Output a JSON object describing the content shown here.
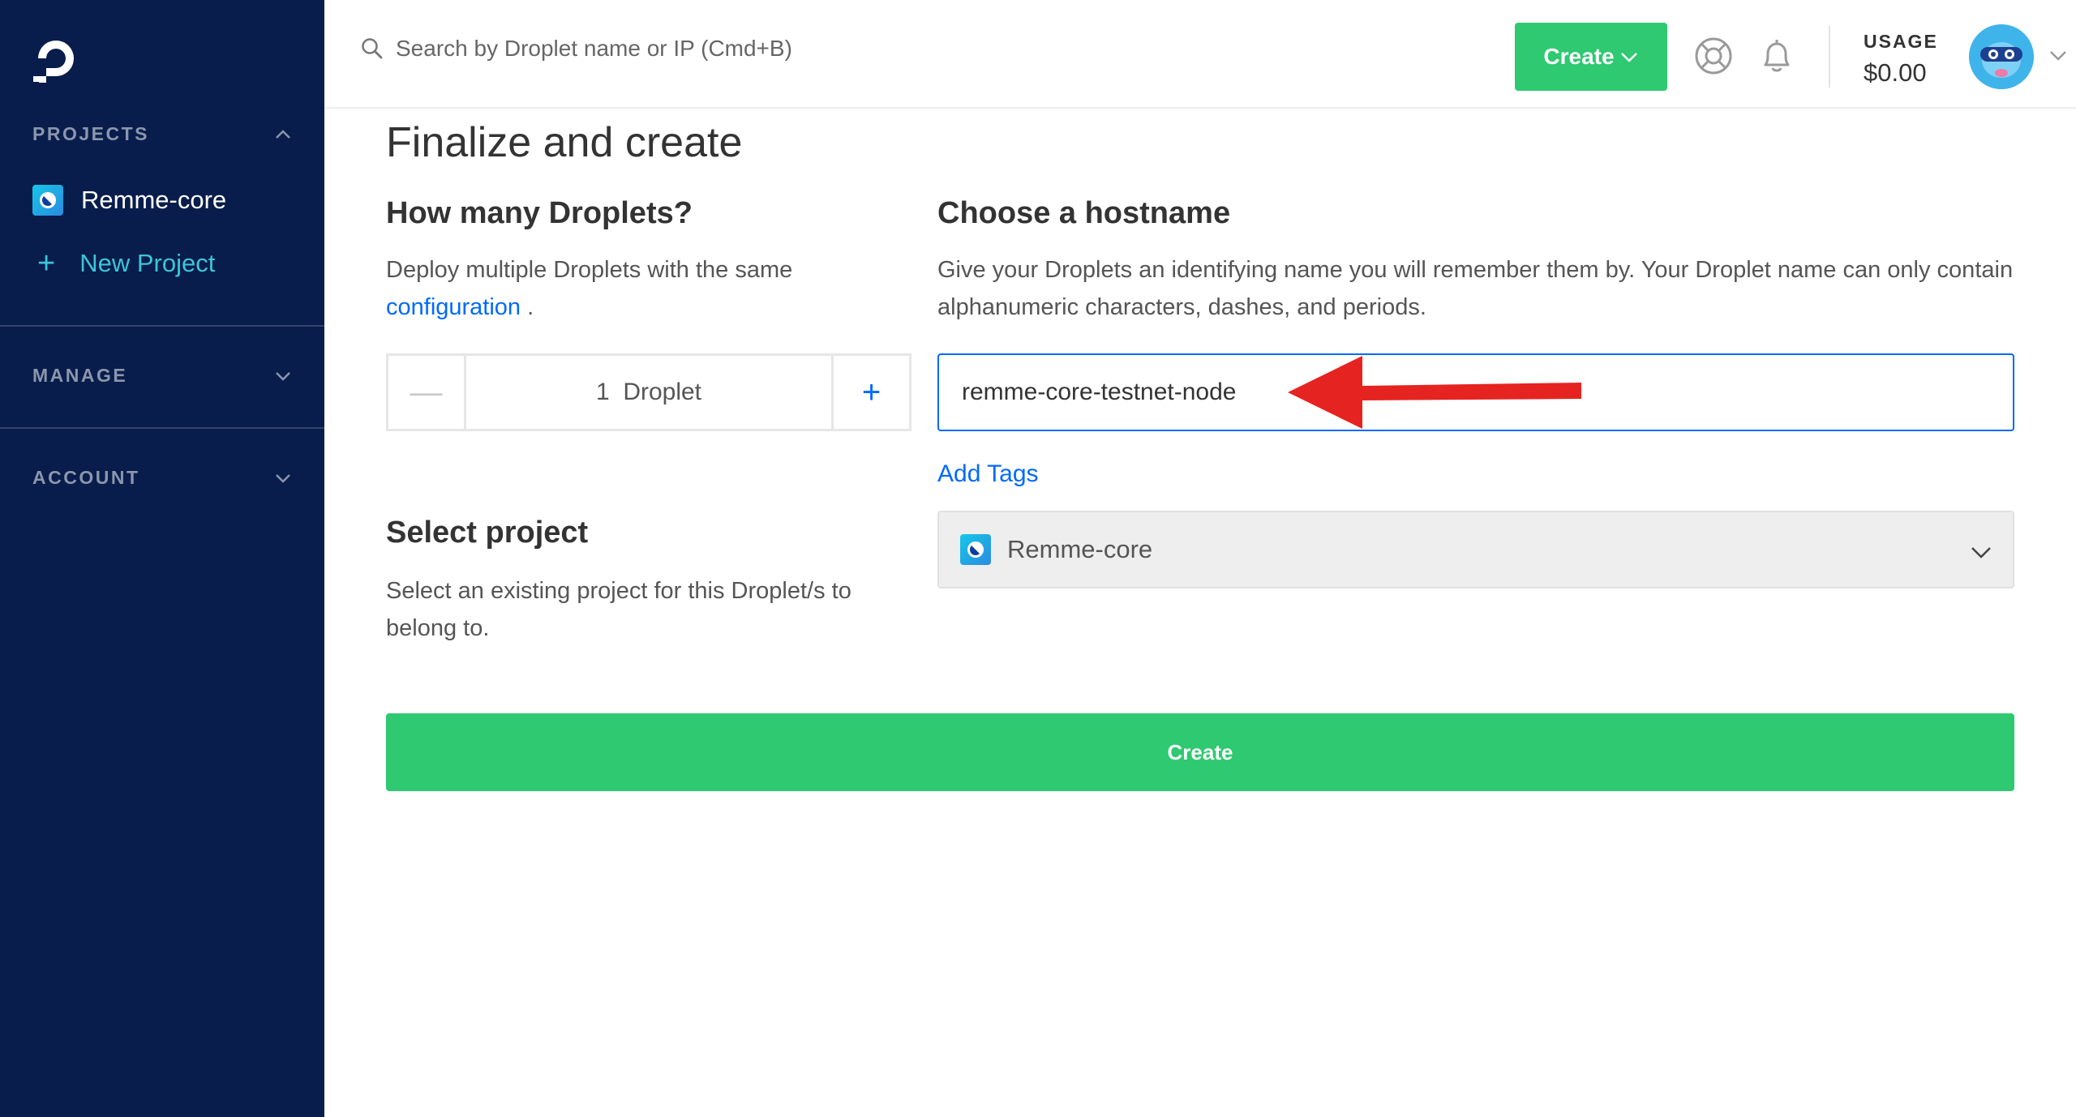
{
  "sidebar": {
    "projects_label": "PROJECTS",
    "current_project": "Remme-core",
    "new_project_label": "New Project",
    "manage_label": "MANAGE",
    "account_label": "ACCOUNT"
  },
  "header": {
    "search_placeholder": "Search by Droplet name or IP (Cmd+B)",
    "create_label": "Create",
    "usage_label": "USAGE",
    "usage_value": "$0.00"
  },
  "main": {
    "title": "Finalize and create",
    "droplets_heading": "How many Droplets?",
    "droplets_desc": "Deploy multiple Droplets with the same",
    "droplets_link": "configuration",
    "droplets_desc_end": " .",
    "droplet_count": "1",
    "droplet_unit": "Droplet",
    "hostname_heading": "Choose a hostname",
    "hostname_desc": "Give your Droplets an identifying name you will remember them by. Your Droplet name can only contain alphanumeric characters, dashes, and periods.",
    "hostname_value": "remme-core-testnet-node",
    "add_tags_label": "Add Tags",
    "project_heading": "Select project",
    "project_desc": "Select an existing project for this Droplet/s to belong to.",
    "selected_project": "Remme-core",
    "create_button_label": "Create"
  },
  "icons": {
    "logo": "digitalocean-logo-icon",
    "search": "search-icon",
    "support": "lifebuoy-icon",
    "notifications": "bell-icon",
    "annotation": "red-arrow-icon"
  },
  "colors": {
    "sidebar_bg": "#081d4b",
    "accent_green": "#2ec971",
    "link_blue": "#0069ff",
    "new_project_teal": "#3dc4d8",
    "arrow_red": "#e52421"
  }
}
